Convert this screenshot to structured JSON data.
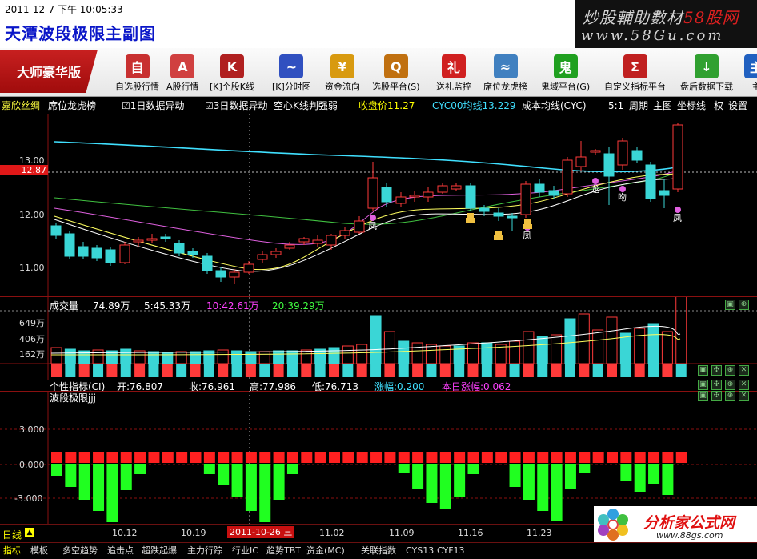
{
  "header": {
    "date": "2011-12-7",
    "ampm": "下午",
    "time": "10:05:33",
    "title": "天潭波段极限主副图",
    "brand_main": "炒股輔助數材",
    "brand_site": "58股网",
    "brand_url": "www.58Gu.com"
  },
  "toolbar": {
    "edition": "大师豪华版",
    "buttons": [
      {
        "label": "自选股行情",
        "icon": "watchlist-icon",
        "color": "#c83030",
        "glyph": "自"
      },
      {
        "label": "A股行情",
        "icon": "a-share-icon",
        "color": "#d04040",
        "glyph": "A"
      },
      {
        "label": "[K]个股K线",
        "icon": "kline-icon",
        "color": "#b02020",
        "glyph": "K"
      },
      {
        "label": "[K]分时图",
        "icon": "timeshare-icon",
        "color": "#3050c0",
        "glyph": "~"
      },
      {
        "label": "资金流向",
        "icon": "money-flow-icon",
        "color": "#d89a10",
        "glyph": "¥"
      },
      {
        "label": "选股平台(S)",
        "icon": "stock-picker-icon",
        "color": "#c07010",
        "glyph": "Q"
      },
      {
        "label": "送礼监控",
        "icon": "gift-icon",
        "color": "#d02020",
        "glyph": "礼"
      },
      {
        "label": "席位龙虎榜",
        "icon": "seat-ranking-icon",
        "color": "#4080c0",
        "glyph": "≈"
      },
      {
        "label": "鬼域平台(G)",
        "icon": "ghost-icon",
        "color": "#20a020",
        "glyph": "鬼"
      },
      {
        "label": "自定义指标平台",
        "icon": "custom-indicator-icon",
        "color": "#c02020",
        "glyph": "Σ"
      },
      {
        "label": "盘后数据下载",
        "icon": "download-icon",
        "color": "#30a030",
        "glyph": "↓"
      },
      {
        "label": "主",
        "icon": "more-icon",
        "color": "#2060c0",
        "glyph": "主"
      }
    ]
  },
  "infobar": {
    "stock_name": "嘉欣丝绸",
    "seat_ranking": "席位龙虎榜",
    "check1": "1日数据异动",
    "check2": "3日数据异动",
    "kline_strength": "空心K线判强弱",
    "close_label": "收盘价11.27",
    "cyc_label": "CYC00均线13.229",
    "cost_label": "成本均线(CYC)",
    "ratio": "5:1",
    "period": "周期",
    "main_chart": "主图",
    "coord_line": "坐标线",
    "rights": "权",
    "settings": "设置"
  },
  "main_chart": {
    "current_price": "12.87",
    "y_ticks": [
      "13.00",
      "12.00",
      "11.00"
    ],
    "markers": [
      "凤",
      "凤",
      "龙",
      "吻",
      "凤"
    ]
  },
  "volume": {
    "title": "成交量",
    "value": "74.89万",
    "ma1": "5:45.33万",
    "ma2": "10:42.61万",
    "ma3": "20:39.29万",
    "y_ticks": [
      "649万",
      "406万",
      "162万"
    ]
  },
  "indicator1": {
    "title": "个性指标(CI)",
    "open": "开:76.807",
    "close": "收:76.961",
    "high": "高:77.986",
    "low": "低:76.713",
    "change": "涨幅:0.200",
    "today_change": "本日涨幅:0.062"
  },
  "indicator2": {
    "title": "波段极限jjj",
    "y_ticks": [
      "3.000",
      "0.000",
      "-3.000"
    ]
  },
  "bottom": {
    "period": "日线",
    "dates": [
      "10.12",
      "10.19",
      "2011-10-26 三",
      "11.02",
      "11.09",
      "11.16",
      "11.23"
    ],
    "logo_text": "分析家公式网",
    "logo_url": "www.88gs.com",
    "tabs": [
      "指标",
      "模板",
      "多空趋势",
      "追击点",
      "超跌起爆",
      "主力行踪",
      "行业IC",
      "趋势TBT",
      "资金(MC)",
      "关联指数",
      "CYS13",
      "CYF13"
    ]
  },
  "colors": {
    "up": "#ff3a3a",
    "down": "#3ad6d6",
    "accent": "#ffff00"
  }
}
